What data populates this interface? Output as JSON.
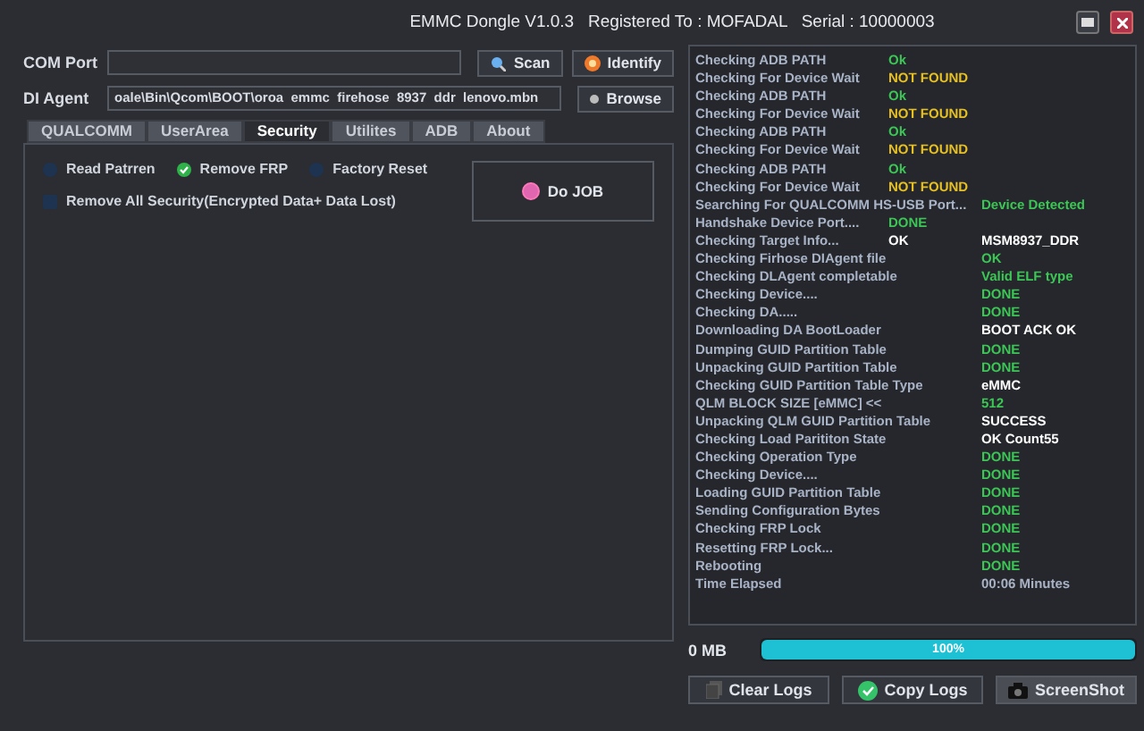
{
  "window": {
    "title": "EMMC Dongle V1.0.3   Registered To : MOFADAL   Serial : 10000003"
  },
  "com_port": {
    "label": "COM Port"
  },
  "scan_button": "Scan",
  "identify_button": "Identify",
  "di_agent": {
    "label": "DI Agent",
    "value": "oale\\Bin\\Qcom\\BOOT\\oroa  emmc  firehose  8937  ddr  lenovo.mbn"
  },
  "browse_button": "Browse",
  "tabs": [
    {
      "label": "QUALCOMM",
      "selected": false
    },
    {
      "label": "UserArea",
      "selected": false
    },
    {
      "label": "Security",
      "selected": true
    },
    {
      "label": "Utilites",
      "selected": false
    },
    {
      "label": "ADB",
      "selected": false
    },
    {
      "label": "About",
      "selected": false
    }
  ],
  "options": [
    {
      "kind": "radio",
      "label": "Read Patrren",
      "checked": false
    },
    {
      "kind": "radio",
      "label": "Remove FRP",
      "checked": true
    },
    {
      "kind": "radio",
      "label": "Factory Reset",
      "checked": false
    },
    {
      "kind": "checkbox",
      "label": "Remove All Security(Encrypted Data+ Data Lost)",
      "checked": false
    }
  ],
  "do_job_button": "Do JOB",
  "log": [
    {
      "label": "Checking ADB PATH",
      "col_2": {
        "text": "Ok",
        "color": "#3cc655"
      }
    },
    {
      "label": "Checking For Device Wait",
      "col_2": {
        "text": "NOT FOUND",
        "color": "#e6c022"
      }
    },
    {
      "label": "Checking ADB PATH",
      "col_2": {
        "text": "Ok",
        "color": "#3cc655"
      }
    },
    {
      "label": "Checking For Device Wait",
      "col_2": {
        "text": "NOT FOUND",
        "color": "#e6c022"
      }
    },
    {
      "label": "Checking ADB PATH",
      "col_2": {
        "text": "Ok",
        "color": "#3cc655"
      }
    },
    {
      "label": "Checking For Device Wait",
      "col_2": {
        "text": "NOT FOUND",
        "color": "#e6c022"
      }
    },
    {
      "label": "Checking ADB PATH",
      "col_2": {
        "text": "Ok",
        "color": "#3cc655"
      }
    },
    {
      "label": "Checking For Device Wait",
      "col_2": {
        "text": "NOT FOUND",
        "color": "#e6c022"
      }
    },
    {
      "label": "Searching For QUALCOMM HS-USB Port...",
      "col_3": {
        "text": "Device Detected",
        "color": "#3cc655"
      }
    },
    {
      "label": "Handshake Device Port....",
      "col_2": {
        "text": "DONE",
        "color": "#3cc655"
      }
    },
    {
      "label": "Checking Target Info...",
      "col_2": {
        "text": "OK",
        "color": "#ffffff"
      },
      "col_3": {
        "text": "MSM8937_DDR",
        "color": "#ffffff"
      }
    },
    {
      "label": "Checking Firhose DIAgent file",
      "col_3": {
        "text": "OK",
        "color": "#3cc655"
      }
    },
    {
      "label": "Checking DLAgent completable",
      "col_3": {
        "text": "Valid ELF type",
        "color": "#3cc655"
      }
    },
    {
      "label": "Checking Device....",
      "col_3": {
        "text": "DONE",
        "color": "#3cc655"
      }
    },
    {
      "label": "Checking DA.....",
      "col_3": {
        "text": "DONE",
        "color": "#3cc655"
      }
    },
    {
      "label": "Downloading DA BootLoader",
      "col_3": {
        "text": "BOOT ACK OK",
        "color": "#ffffff"
      }
    },
    {
      "label": "Dumping GUID Partition Table",
      "col_3": {
        "text": "DONE",
        "color": "#3cc655"
      }
    },
    {
      "label": "Unpacking GUID Partition Table",
      "col_3": {
        "text": "DONE",
        "color": "#3cc655"
      }
    },
    {
      "label": "Checking GUID Partition Table Type",
      "col_3": {
        "text": "eMMC",
        "color": "#ffffff"
      }
    },
    {
      "label": "QLM BLOCK SIZE [eMMC] <<",
      "col_3": {
        "text": "512",
        "color": "#3cc655"
      }
    },
    {
      "label": "Unpacking QLM GUID Partition Table",
      "col_3": {
        "text": "SUCCESS",
        "color": "#ffffff"
      }
    },
    {
      "label": "Checking Load Parititon State",
      "col_3": {
        "text": "OK Count55",
        "color": "#ffffff"
      }
    },
    {
      "label": "Checking Operation Type",
      "col_3": {
        "text": "DONE",
        "color": "#3cc655"
      }
    },
    {
      "label": "Checking Device....",
      "col_3": {
        "text": "DONE",
        "color": "#3cc655"
      }
    },
    {
      "label": "Loading GUID Partition Table",
      "col_3": {
        "text": "DONE",
        "color": "#3cc655"
      }
    },
    {
      "label": "Sending Configuration Bytes",
      "col_3": {
        "text": "DONE",
        "color": "#3cc655"
      }
    },
    {
      "label": "Checking FRP Lock",
      "col_3": {
        "text": "DONE",
        "color": "#3cc655"
      }
    },
    {
      "label": "Resetting FRP Lock...",
      "col_3": {
        "text": "DONE",
        "color": "#3cc655"
      }
    },
    {
      "label": "Rebooting",
      "col_3": {
        "text": "DONE",
        "color": "#3cc655"
      }
    },
    {
      "label": "Time Elapsed",
      "col_3": {
        "text": "00:06  Minutes",
        "color": "#a9b3c6"
      }
    }
  ],
  "size_label": "0 MB",
  "progress": {
    "level": 1,
    "reading": "100%"
  },
  "buttons": [
    {
      "kind": "clear",
      "label": "Clear Logs"
    },
    {
      "kind": "copy",
      "label": "Copy Logs"
    },
    {
      "kind": "camera",
      "label": "ScreenShot"
    }
  ]
}
